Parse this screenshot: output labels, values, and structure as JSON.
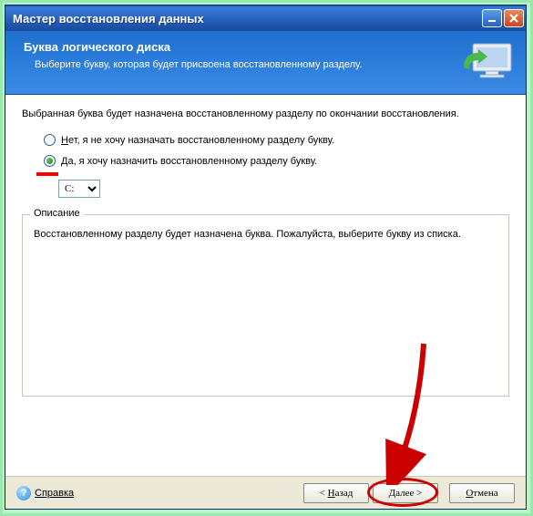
{
  "colors": {
    "accent": "#2862c0",
    "highlight": "#cc0000"
  },
  "titlebar": {
    "title": "Мастер восстановления данных",
    "minimize": "_",
    "close": "X"
  },
  "header": {
    "title": "Буква логического диска",
    "subtitle": "Выберите букву, которая будет присвоена восстановленному разделу."
  },
  "body": {
    "intro": "Выбранная буква будет назначена восстановленному разделу по окончании восстановления.",
    "options": {
      "no_prefix": "Н",
      "no_rest": "ет, я не хочу назначать восстановленному разделу букву.",
      "yes_prefix": "Д",
      "yes_rest": "а, я хочу назначить восстановленному разделу букву."
    },
    "drive_value": "C:"
  },
  "description": {
    "legend": "Описание",
    "text": "Восстановленному разделу будет назначена буква. Пожалуйста, выберите букву из списка."
  },
  "footer": {
    "help": "Справка",
    "back_prefix": "< ",
    "back_u": "Н",
    "back_rest": "азад",
    "next_u": "Д",
    "next_rest": "алее >",
    "cancel_u": "О",
    "cancel_rest": "тмена"
  }
}
